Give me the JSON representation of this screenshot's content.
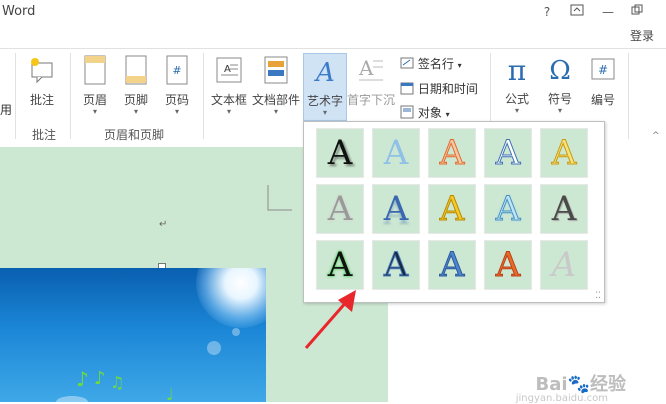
{
  "app_title": "Word",
  "window_controls": {
    "help": "?",
    "restore": "🗖",
    "minimize": "—",
    "maximize": "🗗"
  },
  "login_label": "登录",
  "ribbon": {
    "partial_label": "用",
    "comment_group": {
      "button": "批注",
      "group_label": "批注"
    },
    "header_footer_group": {
      "buttons": [
        "页眉",
        "页脚",
        "页码"
      ],
      "group_label": "页眉和页脚"
    },
    "text_group": {
      "textbox": "文本框",
      "doc_parts": "文档部件",
      "wordart": "艺术字",
      "dropcap": "首字下沉",
      "signature": "签名行",
      "datetime": "日期和时间",
      "object": "对象"
    },
    "symbols_group": {
      "equation": "公式",
      "symbol": "符号",
      "number": "编号"
    }
  },
  "wordart_gallery": {
    "glyph": "A",
    "styles": [
      [
        "black-shadow",
        "light-blue",
        "orange-outline",
        "blue-outline",
        "gold-outline"
      ],
      [
        "gray-soft",
        "blue-reflect",
        "gold-fill",
        "cyan-glow",
        "gray-bevel"
      ],
      [
        "black-green-glow",
        "black-blue",
        "blue-gradient",
        "orange-red",
        "gray-light"
      ]
    ]
  },
  "paragraph_mark": "↵",
  "watermark": {
    "main": "Bai🐾经验",
    "sub": "jingyan.baidu.com"
  },
  "colors": {
    "page": "#cde8d2",
    "ribbon_selected": "#cfe3f5",
    "arrow": "#e8262b"
  }
}
